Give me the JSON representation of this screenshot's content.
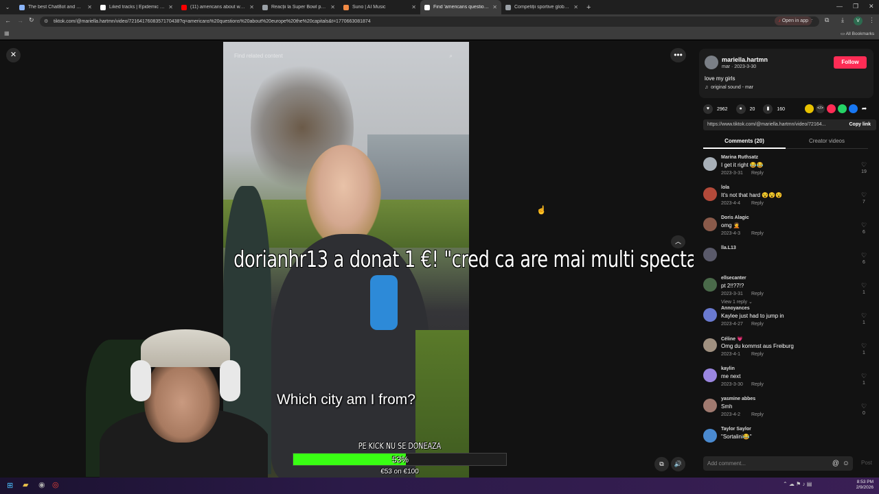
{
  "browser": {
    "tabs": [
      {
        "label": "The best ChatBot and Widgets",
        "color": "#8ab4f8",
        "active": false
      },
      {
        "label": "Liked tracks | Epidemic Sound",
        "color": "#ffffff",
        "active": false
      },
      {
        "label": "(11) americans about world cu",
        "color": "#ff0000",
        "active": false
      },
      {
        "label": "Reacții la Super Bowl pe Kick",
        "color": "#9aa0a6",
        "active": false
      },
      {
        "label": "Suno | AI Music",
        "color": "#f28b45",
        "active": false
      },
      {
        "label": "Find 'americans questions abo",
        "color": "#ffffff",
        "active": true
      },
      {
        "label": "Competiții sportive globale",
        "color": "#9aa0a6",
        "active": false
      }
    ],
    "url": "tiktok.com/@mariella.hartmn/video/7216417608357170438?q=americans%20questions%20about%20europe%20the%20capitals&t=1770663081874",
    "open_in_app": "Open in app",
    "all_bookmarks": "All Bookmarks"
  },
  "video": {
    "search_placeholder": "Find related content",
    "caption": "Which city am I from?"
  },
  "overlay": {
    "donation_text": "dorianhr13 a donat 1 €! \"cred ca are mai multi spectatori insula iubirii\"",
    "goal_title": "PE KICK NU SE DONEAZA",
    "goal_percent_label": "53%",
    "goal_percent": 0.53,
    "goal_amount": "€53 on €100"
  },
  "author": {
    "name": "mariella.hartmn",
    "sub": "mar · 2023-3-30",
    "follow": "Follow",
    "description": "love my girls",
    "sound": "original sound - mar"
  },
  "stats": {
    "likes": "2962",
    "comments": "20",
    "saves": "160"
  },
  "link": {
    "url": "https://www.tiktok.com/@mariella.hartmn/video/72164...",
    "copy": "Copy link"
  },
  "tabs": {
    "comments": "Comments (20)",
    "creator": "Creator videos"
  },
  "comments": [
    {
      "user": "Marina Ruthsatz",
      "text": "I get it right 😂😂",
      "date": "2023-3-31",
      "likes": "19",
      "avatar": "#a8b0b8"
    },
    {
      "user": "lola",
      "text": "It's not that hard 😵😵😵",
      "date": "2023-4-4",
      "likes": "7",
      "avatar": "#b34a3a"
    },
    {
      "user": "Doris Alagic",
      "text": "omg 🤦",
      "date": "2023-4-3",
      "likes": "6",
      "avatar": "#8a5a4a"
    },
    {
      "user": "lla.L13",
      "text": "",
      "date": "",
      "likes": "6",
      "avatar": "#5a5a6a"
    },
    {
      "user": "ellsecanter",
      "text": "pt 2!!?7!?",
      "date": "2023-3-31",
      "likes": "1",
      "avatar": "#4a6a4a",
      "view_replies": "View 1 reply"
    },
    {
      "user": "Annoyances",
      "text": "Kaylee just had to jump in",
      "date": "2023-4-27",
      "likes": "1",
      "avatar": "#6a7ad0"
    },
    {
      "user": "Céline 💗",
      "text": "Omg du kommst aus Freiburg",
      "date": "2023-4-1",
      "likes": "1",
      "avatar": "#a09080"
    },
    {
      "user": "kaylin",
      "text": "me next",
      "date": "2023-3-30",
      "likes": "1",
      "avatar": "#9a86e0"
    },
    {
      "user": "yasmine abbes",
      "text": "Smh",
      "date": "2023-4-2",
      "likes": "0",
      "avatar": "#a07a70"
    },
    {
      "user": "Taylor Saylor",
      "text": "\"Sortalini😂\"",
      "date": "",
      "likes": "",
      "avatar": "#4a8ad0"
    }
  ],
  "reply_label": "Reply",
  "add_comment": "Add comment...",
  "post": "Post",
  "taskbar": {
    "time": "8:53 PM",
    "date": "2/9/2026"
  }
}
